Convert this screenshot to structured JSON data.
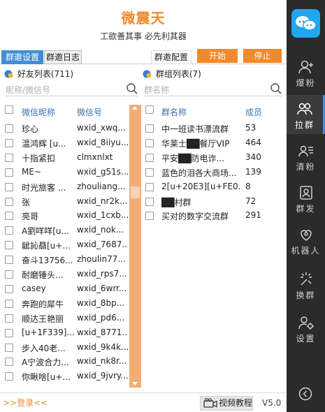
{
  "app": {
    "title": "微震天",
    "slogan": "工欲善其事 必先利其器"
  },
  "tabs": {
    "active": "群邀设置",
    "inactive": "群邀日志",
    "config": "群邀配置"
  },
  "actions": {
    "start": "开始",
    "stop": "停止"
  },
  "friends": {
    "title": "好友列表(711)",
    "search_placeholder": "昵称/微信号",
    "col_name": "微信昵称",
    "col_id": "微信号",
    "rows": [
      {
        "name": "珍心",
        "id": "wxid_xwq..."
      },
      {
        "name": "温鸿辉 [u...",
        "id": "wxid_8iiyu..."
      },
      {
        "name": "十指紧扣",
        "id": "clmxnlxt"
      },
      {
        "name": "ME~",
        "id": "wxid_g51s..."
      },
      {
        "name": "时光旅客 ...",
        "id": "zhouliang..."
      },
      {
        "name": "张",
        "id": "wxid_nr2k..."
      },
      {
        "name": "亮哥",
        "id": "wxid_1cxb..."
      },
      {
        "name": "A劉咩咩[u...",
        "id": "wxid_nok..."
      },
      {
        "name": "龇訫贔[u+...",
        "id": "wxid_7687..."
      },
      {
        "name": "奋斗13756...",
        "id": "zhoulin77..."
      },
      {
        "name": "耐磨锤头...",
        "id": "wxid_rps7..."
      },
      {
        "name": "casey",
        "id": "wxid_6wrr..."
      },
      {
        "name": "奔跑的犀牛",
        "id": "wxid_8bp..."
      },
      {
        "name": "顺达王艳丽",
        "id": "wxid_pd6..."
      },
      {
        "name": "[u+1F339]...",
        "id": "wxid_8771..."
      },
      {
        "name": "步入40老...",
        "id": "wxid_9k4k..."
      },
      {
        "name": "A宁波合力...",
        "id": "wxid_nk8r..."
      },
      {
        "name": "你瞅啥[u+...",
        "id": "wxid_9jvry..."
      }
    ]
  },
  "groups": {
    "title": "群组列表(7)",
    "search_placeholder": "群名称",
    "col_name": "群名称",
    "col_members": "成员",
    "rows": [
      {
        "name": "中一班读书漂流群",
        "members": "53"
      },
      {
        "name": "华莱士██餐厅VIP",
        "members": "464"
      },
      {
        "name": "平安██防电诈...",
        "members": "340"
      },
      {
        "name": "蓝色的泪各大商场...",
        "members": "139"
      },
      {
        "name": "2[u+20E3][u+FE0...",
        "members": "8"
      },
      {
        "name": "██村群",
        "members": "72"
      },
      {
        "name": "买对的数字交流群",
        "members": "291"
      }
    ]
  },
  "footer": {
    "login": ">>登录<<",
    "video": "视频教程",
    "version": "V5.0"
  },
  "sidebar": {
    "items": [
      {
        "label": "爆粉",
        "icon": "add-user-icon"
      },
      {
        "label": "拉群",
        "icon": "group-icon"
      },
      {
        "label": "清粉",
        "icon": "contact-card-icon"
      },
      {
        "label": "群发",
        "icon": "broadcast-icon"
      },
      {
        "label": "机器人",
        "icon": "robot-heart-icon"
      },
      {
        "label": "换群",
        "icon": "sparkle-icon"
      },
      {
        "label": "设置",
        "icon": "user-gear-icon"
      }
    ]
  },
  "colors": {
    "accent": "#f08a2c",
    "tab_active": "#3f8ed6",
    "sidebar_bg": "#2b2b2b",
    "scrollbar": "#f3ad74"
  }
}
